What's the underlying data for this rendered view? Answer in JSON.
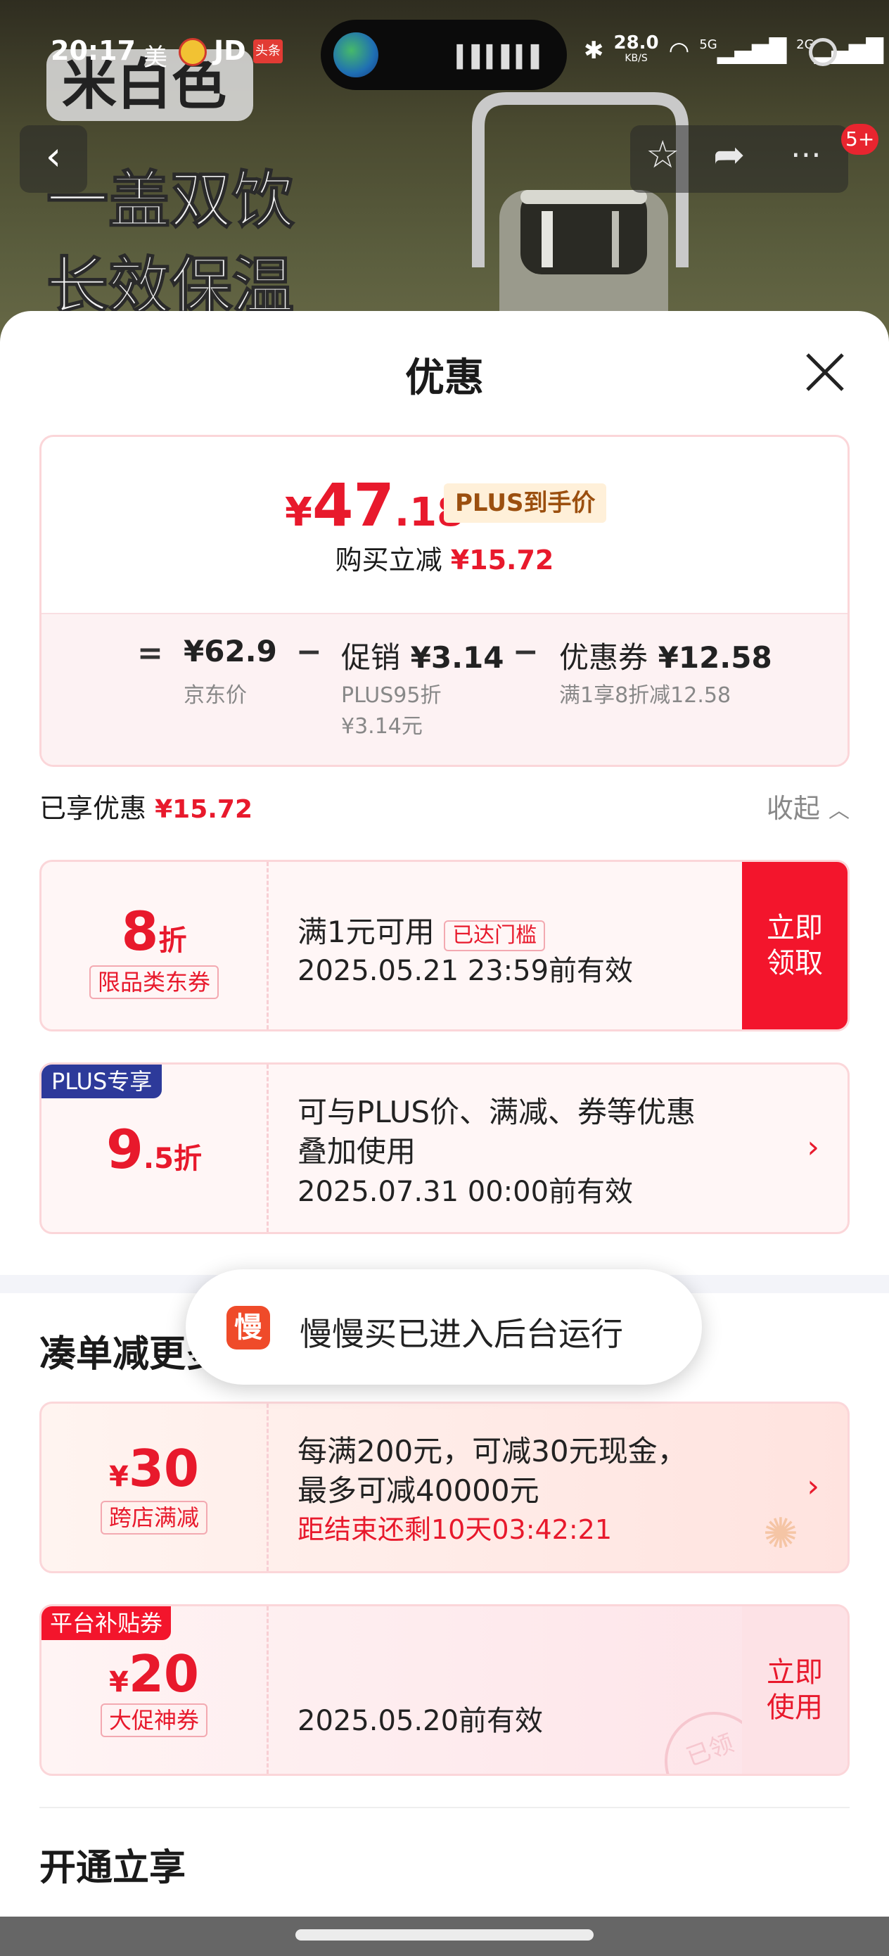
{
  "status_bar": {
    "time": "20:17",
    "carrier_label": "美",
    "jd_label": "JD",
    "toutiao_label": "头条",
    "net_speed": "28.0",
    "net_unit": "KB/S",
    "signal_1": "5G",
    "signal_2": "2G"
  },
  "background": {
    "label_color_name": "米白色",
    "promo_line_1": "一盖双饮",
    "promo_line_2": "长效保温",
    "badge_count": "5+"
  },
  "sheet": {
    "title": "优惠",
    "price": {
      "currency": "¥",
      "integer": "47",
      "decimal": ".18",
      "plus_tag": "PLUS到手价",
      "reduce_label": "购买立减",
      "reduce_value": "¥15.72"
    },
    "breakdown": {
      "eq_sign": "=",
      "minus_sign": "−",
      "jd_price": "¥62.9",
      "jd_price_label": "京东价",
      "promo_label": "促销",
      "promo_value": "¥3.14",
      "promo_sub_1": "PLUS95折",
      "promo_sub_2": "¥3.14元",
      "coupon_label": "优惠券",
      "coupon_value": "¥12.58",
      "coupon_sub": "满1享8折减12.58"
    },
    "enjoyed_label": "已享优惠",
    "enjoyed_value": "¥15.72",
    "collapse_label": "收起",
    "coupons": [
      {
        "value_num": "8",
        "value_unit": "折",
        "tag": "限品类东券",
        "line1": "满1元可用",
        "threshold_tag": "已达门槛",
        "line2": "2025.05.21 23:59前有效",
        "action": "立即领取"
      },
      {
        "corner": "PLUS专享",
        "value_num": "9",
        "value_unit": ".5折",
        "line1": "可与PLUS价、满减、券等优惠",
        "line1b": "叠加使用",
        "line2": "2025.07.31 00:00前有效"
      }
    ],
    "more_title": "凑单减更多",
    "more": [
      {
        "currency": "¥",
        "value": "30",
        "tag": "跨店满减",
        "line1": "每满200元，可减30元现金，",
        "line2": "最多可减40000元",
        "countdown": "距结束还剩10天03:42:21"
      },
      {
        "corner": "平台补贴券",
        "currency": "¥",
        "value": "20",
        "tag": "大促神券",
        "line2": "2025.05.20前有效",
        "action": "立即使用",
        "stamp": "已领"
      }
    ],
    "open_title": "开通立享"
  },
  "toast": {
    "icon_char": "慢",
    "message": "慢慢买已进入后台运行"
  },
  "colors": {
    "accent_red": "#e8192c",
    "plus_blue": "#2d3a9a",
    "plus_gold_bg": "#fff0d9"
  }
}
